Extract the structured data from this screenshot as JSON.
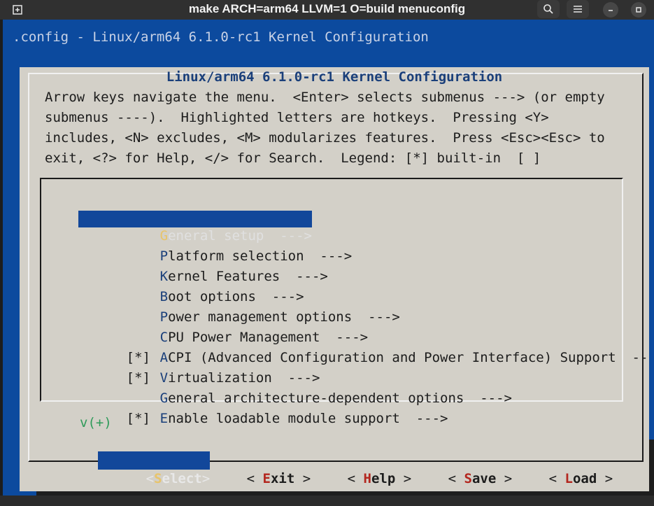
{
  "window": {
    "title": "make ARCH=arm64 LLVM=1 O=build menuconfig"
  },
  "terminal": {
    "header": ".config - Linux/arm64 6.1.0-rc1 Kernel Configuration",
    "dialog_title": "Linux/arm64 6.1.0-rc1 Kernel Configuration",
    "help_lines": [
      "Arrow keys navigate the menu.  <Enter> selects submenus ---> (or empty",
      "submenus ----).  Highlighted letters are hotkeys.  Pressing <Y>",
      "includes, <N> excludes, <M> modularizes features.  Press <Esc><Esc> to",
      "exit, <?> for Help, </> for Search.  Legend: [*] built-in  [ ]"
    ],
    "menu_items": [
      {
        "prefix": "",
        "hotkey": "G",
        "rest": "eneral setup  --->"
      },
      {
        "prefix": "",
        "hotkey": "P",
        "rest": "latform selection  --->"
      },
      {
        "prefix": "",
        "hotkey": "K",
        "rest": "ernel Features  --->"
      },
      {
        "prefix": "",
        "hotkey": "B",
        "rest": "oot options  --->"
      },
      {
        "prefix": "",
        "hotkey": "P",
        "rest": "ower management options  --->"
      },
      {
        "prefix": "",
        "hotkey": "C",
        "rest": "PU Power Management  --->"
      },
      {
        "prefix": "[*]",
        "hotkey": "A",
        "rest": "CPI (Advanced Configuration and Power Interface) Support  --"
      },
      {
        "prefix": "[*]",
        "hotkey": "V",
        "rest": "irtualization  --->"
      },
      {
        "prefix": "",
        "hotkey": "G",
        "rest": "eneral architecture-dependent options  --->"
      },
      {
        "prefix": "[*]",
        "hotkey": "E",
        "rest": "nable loadable module support  --->"
      }
    ],
    "more_indicator": "v(+)",
    "buttons": [
      {
        "open": "<",
        "hotkey": "S",
        "rest": "elect",
        "close": ">"
      },
      {
        "open": "< ",
        "hotkey": "E",
        "rest": "xit",
        "close": " >"
      },
      {
        "open": "< ",
        "hotkey": "H",
        "rest": "elp",
        "close": " >"
      },
      {
        "open": "< ",
        "hotkey": "S",
        "rest": "ave",
        "close": " >"
      },
      {
        "open": "< ",
        "hotkey": "L",
        "rest": "oad",
        "close": " >"
      }
    ]
  }
}
